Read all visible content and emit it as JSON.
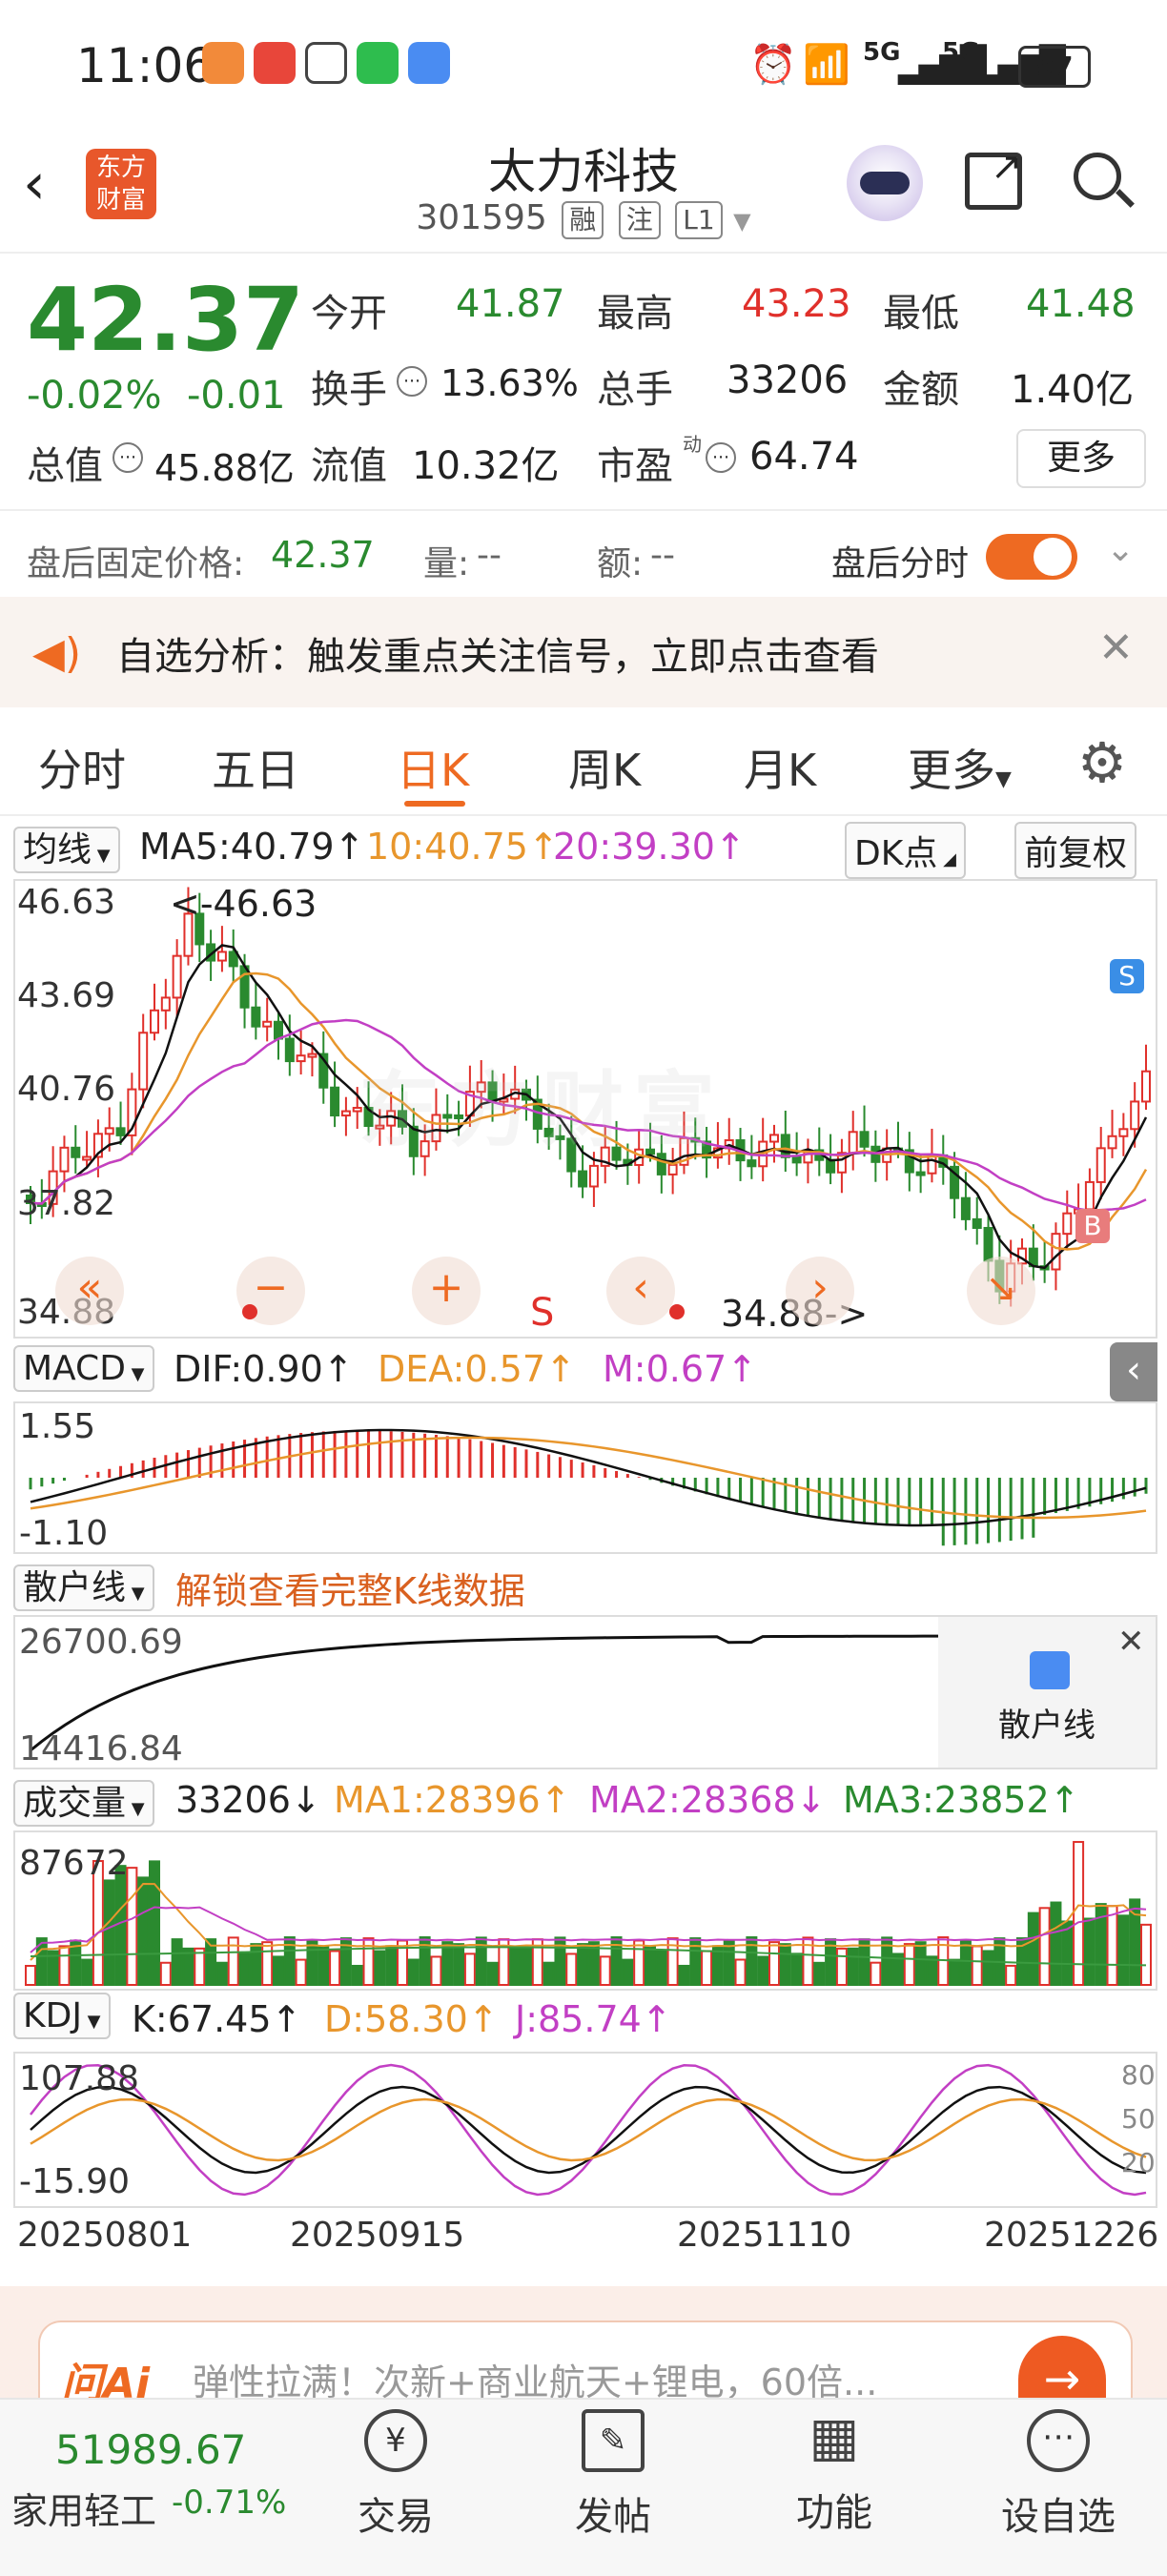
{
  "status": {
    "time": "11:06",
    "signal1": "5G",
    "signal2": "5G",
    "battery": "97"
  },
  "header": {
    "back_icon": "back-arrow-icon",
    "logo_line1": "东方",
    "logo_line2": "财富",
    "title": "太力科技",
    "code": "301595",
    "tags": [
      "融",
      "注",
      "L1"
    ]
  },
  "quote": {
    "price": "42.37",
    "change_pct": "-0.02%",
    "change": "-0.01",
    "open_label": "今开",
    "open": "41.87",
    "high_label": "最高",
    "high": "43.23",
    "low_label": "最低",
    "low": "41.48",
    "turnover_label": "换手",
    "turnover": "13.63%",
    "volume_label": "总手",
    "volume": "33206",
    "amount_label": "金额",
    "amount": "1.40亿",
    "mktcap_label": "总值",
    "mktcap": "45.88亿",
    "float_label": "流值",
    "float_cap": "10.32亿",
    "pe_label": "市盈",
    "pe_sup": "动",
    "pe": "64.74",
    "more_button": "更多"
  },
  "after_hours": {
    "price_label": "盘后固定价格:",
    "price": "42.37",
    "vol_label": "量:",
    "vol": "--",
    "amt_label": "额:",
    "amt": "--",
    "toggle_label": "盘后分时"
  },
  "banner": {
    "text": "自选分析：触发重点关注信号，立即点击查看"
  },
  "tabs": [
    "分时",
    "五日",
    "日K",
    "周K",
    "月K",
    "更多"
  ],
  "active_tab": 2,
  "kline": {
    "selector": "均线",
    "ma5": "MA5:40.79↑",
    "ma10": "10:40.75↑",
    "ma20": "20:39.30↑",
    "dk_button": "DK点",
    "adjust_button": "前复权",
    "y_labels": [
      "46.63",
      "43.69",
      "40.76",
      "37.82",
      "34.88"
    ],
    "max_marker": "<-46.63",
    "min_marker": "34.88->",
    "s_marker": "S",
    "b_marker": "B",
    "watermark": "东方财富"
  },
  "macd": {
    "selector": "MACD",
    "dif": "DIF:0.90↑",
    "dea": "DEA:0.57↑",
    "m": "M:0.67↑",
    "y_top": "1.55",
    "y_bottom": "-1.10"
  },
  "retail": {
    "selector": "散户线",
    "unlock_text": "解锁查看完整K线数据",
    "y_top": "26700.69",
    "y_bottom": "14416.84",
    "badge_label": "散户线"
  },
  "volume": {
    "selector": "成交量",
    "vol": "33206↓",
    "ma1": "MA1:28396↑",
    "ma2": "MA2:28368↓",
    "ma3": "MA3:23852↑",
    "y_top": "87672"
  },
  "kdj": {
    "selector": "KDJ",
    "k": "K:67.45↑",
    "d": "D:58.30↑",
    "j": "J:85.74↑",
    "y_top": "107.88",
    "y_bottom": "-15.90",
    "r80": "80",
    "r50": "50",
    "r20": "20"
  },
  "dates": [
    "20250801",
    "20250915",
    "20251110",
    "20251226"
  ],
  "ai_bar": {
    "logo": "问Ai",
    "text": "弹性拉满！次新+商业航天+锂电，60倍..."
  },
  "bottom_nav": {
    "index_value": "51989.67",
    "index_name": "家用轻工",
    "index_change": "-0.71%",
    "items": [
      "交易",
      "发帖",
      "功能",
      "设自选"
    ]
  },
  "colors": {
    "up": "#e0302b",
    "down": "#2a8a2f",
    "accent": "#ee6a22",
    "ma10": "#e8962c",
    "ma20": "#c23fc4"
  }
}
